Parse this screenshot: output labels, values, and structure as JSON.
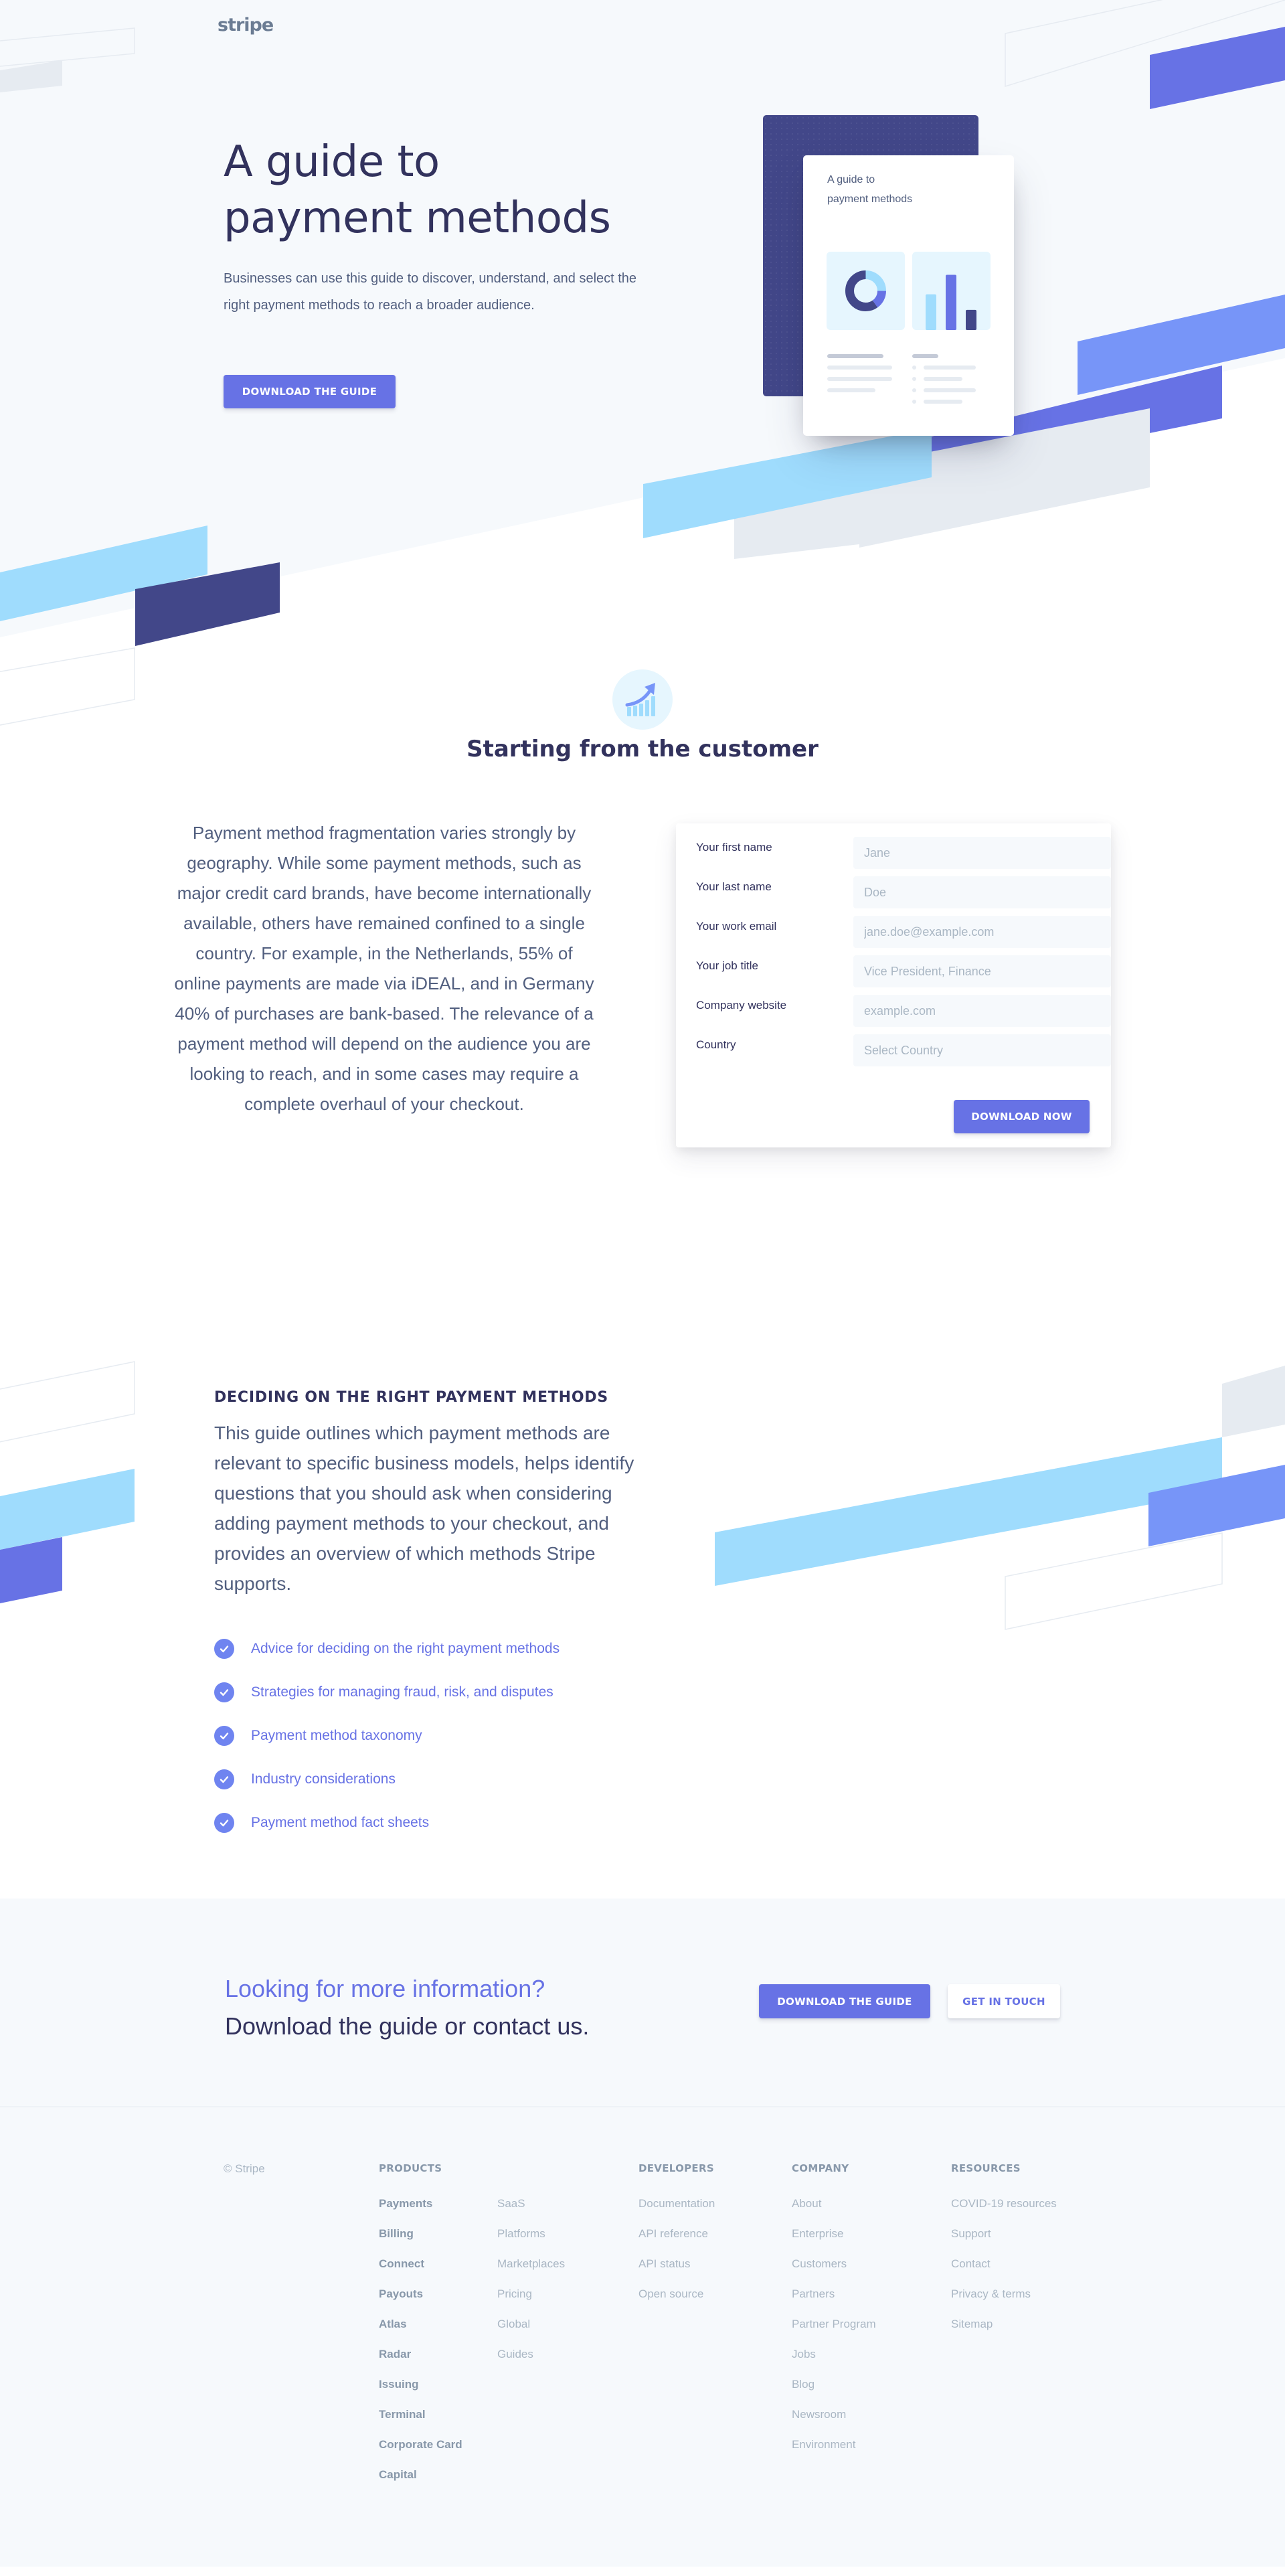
{
  "brand": {
    "logo_text": "stripe"
  },
  "colors": {
    "accent": "#6772e5",
    "dark_navy": "#32325d",
    "booklet_navy": "#424789",
    "light_blue": "#9fdcfd",
    "periwinkle": "#7795f8",
    "pale_gray": "#e6ebf1",
    "background": "#f6f9fc"
  },
  "hero": {
    "title": "A guide to payment methods",
    "description": "Businesses can use this guide to discover, understand, and select the right payment methods to reach a broader audience.",
    "button_label": "Download the guide",
    "booklet": {
      "title_line1": "A guide to",
      "title_line2": "payment methods",
      "donut_segments": [
        {
          "label": "light-blue",
          "fraction": 0.25,
          "color": "#9fdcfd"
        },
        {
          "label": "indigo",
          "fraction": 0.15,
          "color": "#6772e5"
        },
        {
          "label": "navy",
          "fraction": 0.6,
          "color": "#424789"
        }
      ],
      "bars": [
        {
          "value": 0.62,
          "color": "#9fdcfd"
        },
        {
          "value": 0.96,
          "color": "#6772e5"
        },
        {
          "value": 0.35,
          "color": "#424789"
        }
      ]
    }
  },
  "customer_section": {
    "icon": "growth-chart-icon",
    "title": "Starting from the customer",
    "body": "Payment method fragmentation varies strongly by geography. While some payment methods, such as major credit card brands, have become internationally available, others have remained confined to a single country. For example, in the Netherlands, 55% of online payments are made via iDEAL, and in Germany 40% of purchases are bank-based. The relevance of a payment method will depend on the audience you are looking to reach, and in some cases may require a complete overhaul of your checkout."
  },
  "form": {
    "fields": [
      {
        "label": "Your first name",
        "placeholder": "Jane",
        "value": ""
      },
      {
        "label": "Your last name",
        "placeholder": "Doe",
        "value": ""
      },
      {
        "label": "Your work email",
        "placeholder": "jane.doe@example.com",
        "value": ""
      },
      {
        "label": "Your job title",
        "placeholder": "Vice President, Finance",
        "value": ""
      },
      {
        "label": "Company website",
        "placeholder": "example.com",
        "value": ""
      },
      {
        "label": "Country",
        "placeholder": "Select Country",
        "value": ""
      }
    ],
    "submit_label": "Download now"
  },
  "deciding_section": {
    "title": "Deciding on the right payment methods",
    "body": "This guide outlines which payment methods are relevant to specific business models, helps identify questions that you should ask when considering adding payment methods to your checkout, and provides an overview of which methods Stripe supports.",
    "checklist": [
      "Advice for deciding on the right payment methods",
      "Strategies for managing fraud, risk, and disputes",
      "Payment method taxonomy",
      "Industry considerations",
      "Payment method fact sheets"
    ]
  },
  "cta": {
    "subtitle": "Looking for more information?",
    "title": "Download the guide or contact us.",
    "primary_label": "Download the guide",
    "secondary_label": "Get in touch"
  },
  "footer": {
    "copyright": "© Stripe",
    "products": {
      "heading": "Products",
      "primary": [
        "Payments",
        "Billing",
        "Connect",
        "Payouts",
        "Atlas",
        "Radar",
        "Issuing",
        "Terminal",
        "Corporate Card",
        "Capital"
      ],
      "secondary": [
        "SaaS",
        "Platforms",
        "Marketplaces",
        "Pricing",
        "Global",
        "Guides"
      ]
    },
    "developers": {
      "heading": "Developers",
      "links": [
        "Documentation",
        "API reference",
        "API status",
        "Open source"
      ]
    },
    "company": {
      "heading": "Company",
      "links": [
        "About",
        "Enterprise",
        "Customers",
        "Partners",
        "Partner Program",
        "Jobs",
        "Blog",
        "Newsroom",
        "Environment"
      ]
    },
    "resources": {
      "heading": "Resources",
      "links": [
        "COVID-19 resources",
        "Support",
        "Contact",
        "Privacy & terms",
        "Sitemap"
      ]
    }
  }
}
